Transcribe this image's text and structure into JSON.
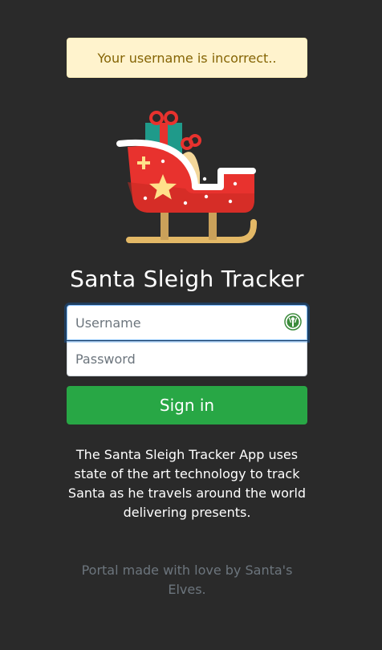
{
  "alert": {
    "message": "Your username is incorrect.."
  },
  "logo": {
    "icon": "santa-sleigh-icon"
  },
  "title": "Santa Sleigh Tracker",
  "form": {
    "username_placeholder": "Username",
    "username_value": "",
    "password_placeholder": "Password",
    "password_value": "",
    "password_manager_icon": "password-manager-icon",
    "submit_label": "Sign in"
  },
  "description": "The Santa Sleigh Tracker App uses state of the art technology to track Santa as he travels around the world delivering presents.",
  "footer": "Portal made with love by Santa's Elves.",
  "colors": {
    "background": "#2a2a2a",
    "alert_background": "#fff3cd",
    "alert_text": "#856404",
    "button": "#28a745",
    "footer_text": "#6c757d"
  }
}
